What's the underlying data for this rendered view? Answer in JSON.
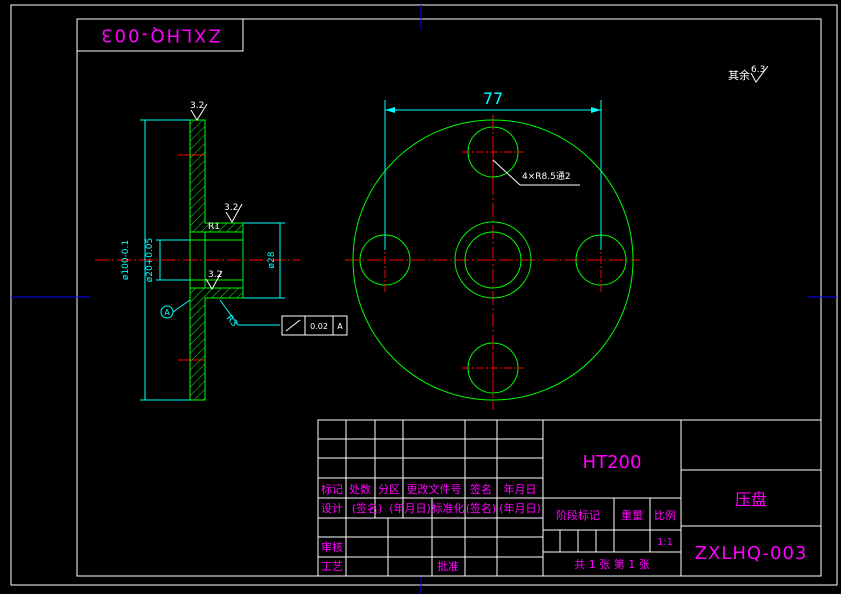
{
  "drawing": {
    "code": "ZXLHQ-003",
    "material": "HT200",
    "part_name": "压盘",
    "scale": "1:1",
    "sheet_info": "共 1 张 第 1 张",
    "roughness_note": {
      "text": "其余",
      "value": "6.3"
    }
  },
  "title_block": {
    "row_headers": [
      "标记",
      "处数",
      "分区",
      "更改文件号",
      "签名",
      "年月日"
    ],
    "design_row": [
      "设计",
      "(签名)",
      "(年月日)",
      "标准化",
      "(签名)",
      "(年月日)"
    ],
    "stage_headers": [
      "阶段标记",
      "重量",
      "比例"
    ],
    "review": "审核",
    "process": "工艺",
    "approve": "批准"
  },
  "dimensions": {
    "bolt_circle": "77",
    "hole_callout": "4×R8.5通2",
    "outer_dia": "ø100-0.1",
    "inner_dia": "ø20+0.05",
    "bore_dia": "ø28",
    "radius_top": "R1",
    "radius_bottom": "R3",
    "roughness_values": [
      "3.2",
      "3.2",
      "3.2"
    ],
    "datum": "A",
    "tolerance": {
      "value": "0.02",
      "datum": "A"
    }
  },
  "colors": {
    "border": "#ffffff",
    "outline": "#00ff00",
    "dimension": "#00ffff",
    "centerline": "#ff0000",
    "title_text": "#ff00ff",
    "edge_marks": "#0000ff"
  }
}
